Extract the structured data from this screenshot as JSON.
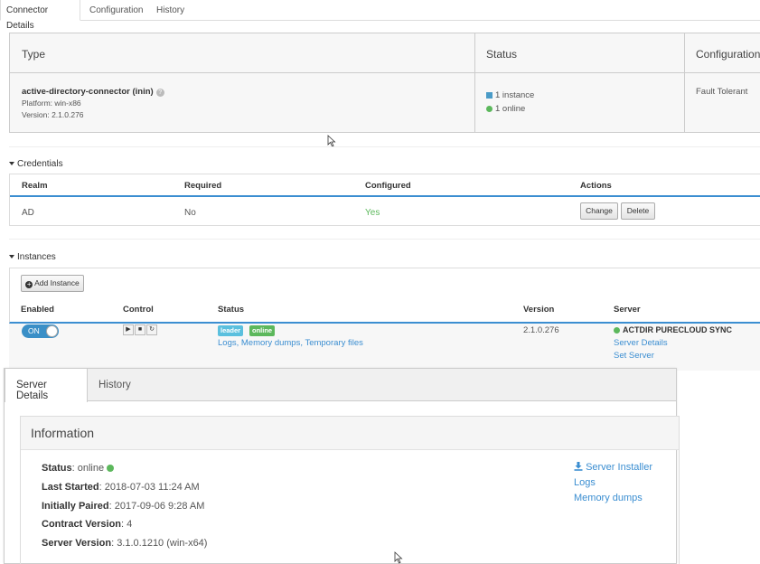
{
  "tabs": [
    "Connector Details",
    "Configuration",
    "History"
  ],
  "type_panel": {
    "headers": [
      "Type",
      "Status",
      "Configuration"
    ],
    "name": "active-directory-connector (inin)",
    "platform": "Platform: win-x86",
    "version": "Version: 2.1.0.276",
    "status_instances": "1 instance",
    "status_online": "1 online",
    "configuration": "Fault Tolerant"
  },
  "credentials": {
    "heading": "Credentials",
    "headers": [
      "Realm",
      "Required",
      "Configured",
      "Actions"
    ],
    "row": {
      "realm": "AD",
      "required": "No",
      "configured": "Yes"
    },
    "change_label": "Change",
    "delete_label": "Delete"
  },
  "instances": {
    "heading": "Instances",
    "add_label": "Add Instance",
    "headers": [
      "Enabled",
      "Control",
      "Status",
      "Version",
      "Server"
    ],
    "row": {
      "toggle": "ON",
      "badge_leader": "leader",
      "badge_online": "online",
      "links": "Logs, Memory dumps, Temporary files",
      "version": "2.1.0.276",
      "server_name": "ACTDIR PURECLOUD SYNC",
      "server_details": "Server Details",
      "set_server": "Set Server"
    }
  },
  "overlay": {
    "tabs": [
      "Server Details",
      "History"
    ],
    "info_title": "Information",
    "rows": [
      {
        "label": "Status",
        "value": "online"
      },
      {
        "label": "Last Started",
        "value": "2018-07-03 11:24 AM"
      },
      {
        "label": "Initially Paired",
        "value": "2017-09-06 9:28 AM"
      },
      {
        "label": "Contract Version",
        "value": "4"
      },
      {
        "label": "Server Version",
        "value": "3.1.0.1210 (win-x64)"
      }
    ],
    "links": [
      "Server Installer",
      "Logs",
      "Memory dumps"
    ]
  },
  "colors": {
    "accent": "#3b8ed1",
    "online_green": "#5cb85c",
    "leader_badge": "#5bc0de",
    "toggle_blue": "#3a8fc7"
  }
}
